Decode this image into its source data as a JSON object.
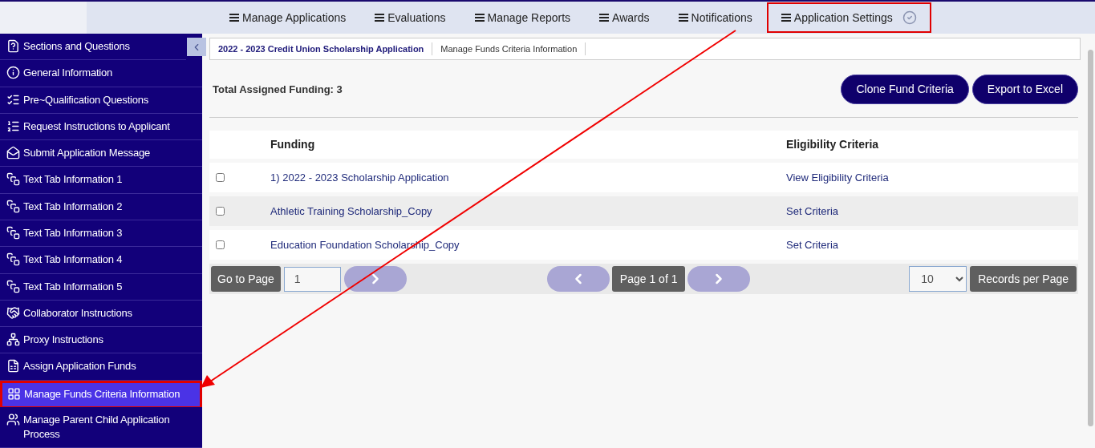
{
  "top_nav": [
    {
      "label": "Manage Applications",
      "highlighted": false,
      "completed": false
    },
    {
      "label": "Evaluations",
      "highlighted": false,
      "completed": false
    },
    {
      "label": "Manage Reports",
      "highlighted": false,
      "completed": false
    },
    {
      "label": "Awards",
      "highlighted": false,
      "completed": false
    },
    {
      "label": "Notifications",
      "highlighted": false,
      "completed": false
    },
    {
      "label": "Application Settings",
      "highlighted": true,
      "completed": true
    }
  ],
  "sidebar": {
    "items": [
      {
        "label": "Sections and Questions",
        "selected": false
      },
      {
        "label": "General Information",
        "selected": false
      },
      {
        "label": "Pre~Qualification Questions",
        "selected": false
      },
      {
        "label": "Request Instructions to Applicant",
        "selected": false
      },
      {
        "label": "Submit Application Message",
        "selected": false
      },
      {
        "label": "Text Tab Information 1",
        "selected": false
      },
      {
        "label": "Text Tab Information 2",
        "selected": false
      },
      {
        "label": "Text Tab Information 3",
        "selected": false
      },
      {
        "label": "Text Tab Information 4",
        "selected": false
      },
      {
        "label": "Text Tab Information 5",
        "selected": false
      },
      {
        "label": "Collaborator Instructions",
        "selected": false
      },
      {
        "label": "Proxy Instructions",
        "selected": false
      },
      {
        "label": "Assign Application Funds",
        "selected": false
      },
      {
        "label": "Manage Funds Criteria Information",
        "selected": true
      },
      {
        "label": "Manage Parent Child Application Process",
        "selected": false
      }
    ]
  },
  "breadcrumb": [
    "2022 - 2023 Credit Union Scholarship Application",
    "Manage Funds Criteria Information"
  ],
  "total_label": "Total Assigned Funding: 3",
  "actions": [
    "Clone Fund Criteria",
    "Export to Excel"
  ],
  "table": {
    "columns": [
      "Funding",
      "Eligibility Criteria"
    ],
    "rows": [
      {
        "checked": false,
        "funding": "1) 2022 - 2023 Scholarship Application",
        "criteria": "View Eligibility Criteria"
      },
      {
        "checked": false,
        "funding": "Athletic Training Scholarship_Copy",
        "criteria": "Set Criteria"
      },
      {
        "checked": false,
        "funding": "Education Foundation Scholarship_Copy",
        "criteria": "Set Criteria"
      }
    ]
  },
  "pagination": {
    "go_to_label": "Go to Page",
    "page_value": "1",
    "page_info": "Page 1 of 1",
    "per_page_value": "10",
    "per_page_label": "Records per Page"
  }
}
